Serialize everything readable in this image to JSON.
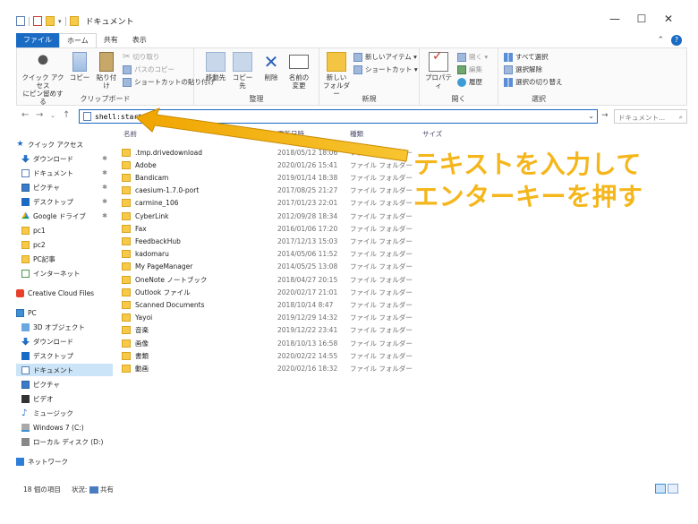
{
  "titlebar": {
    "title": "ドキュメント",
    "minimize": "—",
    "maximize": "☐",
    "close": "✕"
  },
  "tabs": [
    {
      "label": "ファイル"
    },
    {
      "label": "ホーム"
    },
    {
      "label": "共有"
    },
    {
      "label": "表示"
    }
  ],
  "ribbon": {
    "clipboard": {
      "label": "クリップボード",
      "pin": "クイック アクセス\nにピン留めする",
      "copy": "コピー",
      "paste": "貼り付け",
      "cut": "切り取り",
      "copy_path": "パスのコピー",
      "paste_shortcut": "ショートカットの貼り付け"
    },
    "organize": {
      "label": "整理",
      "move_to": "移動先",
      "copy_to": "コピー先",
      "delete": "削除",
      "rename": "名前の\n変更"
    },
    "new": {
      "label": "新規",
      "new_folder": "新しい\nフォルダー",
      "new_item": "新しいアイテム ▾",
      "easy_access": "ショートカット ▾"
    },
    "open": {
      "label": "開く",
      "properties": "プロパティ",
      "open": "開く ▾",
      "edit": "編集",
      "history": "履歴"
    },
    "select": {
      "label": "選択",
      "select_all": "すべて選択",
      "select_none": "選択解除",
      "invert": "選択の切り替え"
    }
  },
  "address": {
    "value": "shell:startup",
    "search_placeholder": "ドキュメント...",
    "search_icon": "search-icon"
  },
  "nav": [
    {
      "label": "クイック アクセス",
      "icon": "star",
      "pinned": false
    },
    {
      "label": "ダウンロード",
      "icon": "down",
      "pinned": true
    },
    {
      "label": "ドキュメント",
      "icon": "doc",
      "pinned": true
    },
    {
      "label": "ピクチャ",
      "icon": "pic",
      "pinned": true
    },
    {
      "label": "デスクトップ",
      "icon": "desk",
      "pinned": true
    },
    {
      "label": "Google ドライブ",
      "icon": "gdrive",
      "pinned": true
    },
    {
      "label": "pc1",
      "icon": "folder",
      "pinned": false
    },
    {
      "label": "pc2",
      "icon": "folder",
      "pinned": false
    },
    {
      "label": "PC記事",
      "icon": "folder",
      "pinned": false
    },
    {
      "label": "インターネット",
      "icon": "net",
      "pinned": false
    },
    {
      "label": "Creative Cloud Files",
      "icon": "cc",
      "pinned": false
    },
    {
      "label": "PC",
      "icon": "pc",
      "pinned": false
    },
    {
      "label": "3D オブジェクト",
      "icon": "3d",
      "pinned": false
    },
    {
      "label": "ダウンロード",
      "icon": "down",
      "pinned": false
    },
    {
      "label": "デスクトップ",
      "icon": "desk",
      "pinned": false
    },
    {
      "label": "ドキュメント",
      "icon": "doc",
      "pinned": false,
      "selected": true
    },
    {
      "label": "ピクチャ",
      "icon": "pic",
      "pinned": false
    },
    {
      "label": "ビデオ",
      "icon": "video",
      "pinned": false
    },
    {
      "label": "ミュージック",
      "icon": "music",
      "pinned": false
    },
    {
      "label": "Windows 7 (C:)",
      "icon": "drive",
      "pinned": false
    },
    {
      "label": "ローカル ディスク (D:)",
      "icon": "ldisk",
      "pinned": false
    },
    {
      "label": "ネットワーク",
      "icon": "network",
      "pinned": false
    }
  ],
  "columns": {
    "name": "名前",
    "date": "更新日時",
    "type": "種類",
    "size": "サイズ"
  },
  "files": [
    {
      "name": ".tmp.drivedownload",
      "date": "2018/05/12 18:06",
      "type": "ファイル フォルダー"
    },
    {
      "name": "Adobe",
      "date": "2020/01/26 15:41",
      "type": "ファイル フォルダー"
    },
    {
      "name": "Bandicam",
      "date": "2019/01/14 18:38",
      "type": "ファイル フォルダー"
    },
    {
      "name": "caesium-1.7.0-port",
      "date": "2017/08/25 21:27",
      "type": "ファイル フォルダー"
    },
    {
      "name": "carmine_106",
      "date": "2017/01/23 22:01",
      "type": "ファイル フォルダー"
    },
    {
      "name": "CyberLink",
      "date": "2012/09/28 18:34",
      "type": "ファイル フォルダー"
    },
    {
      "name": "Fax",
      "date": "2016/01/06 17:20",
      "type": "ファイル フォルダー"
    },
    {
      "name": "FeedbackHub",
      "date": "2017/12/13 15:03",
      "type": "ファイル フォルダー"
    },
    {
      "name": "kadomaru",
      "date": "2014/05/06 11:52",
      "type": "ファイル フォルダー"
    },
    {
      "name": "My PageManager",
      "date": "2014/05/25 13:08",
      "type": "ファイル フォルダー"
    },
    {
      "name": "OneNote ノートブック",
      "date": "2018/04/27 20:15",
      "type": "ファイル フォルダー"
    },
    {
      "name": "Outlook ファイル",
      "date": "2020/02/17 21:01",
      "type": "ファイル フォルダー"
    },
    {
      "name": "Scanned Documents",
      "date": "2018/10/14 8:47",
      "type": "ファイル フォルダー"
    },
    {
      "name": "Yayoi",
      "date": "2019/12/29 14:32",
      "type": "ファイル フォルダー"
    },
    {
      "name": "音楽",
      "date": "2019/12/22 23:41",
      "type": "ファイル フォルダー"
    },
    {
      "name": "画像",
      "date": "2018/10/13 16:58",
      "type": "ファイル フォルダー"
    },
    {
      "name": "書類",
      "date": "2020/02/22 14:55",
      "type": "ファイル フォルダー"
    },
    {
      "name": "動画",
      "date": "2020/02/16 18:32",
      "type": "ファイル フォルダー"
    }
  ],
  "status": {
    "count": "18 個の項目",
    "state": "状況:",
    "shared": "共有"
  },
  "annotation": {
    "line1": "テキストを入力して",
    "line2": "エンターキーを押す",
    "color": "#f4b61b"
  },
  "colors": {
    "accent": "#1a6bc4",
    "selection": "#cce4f7",
    "folder": "#f7c948"
  }
}
